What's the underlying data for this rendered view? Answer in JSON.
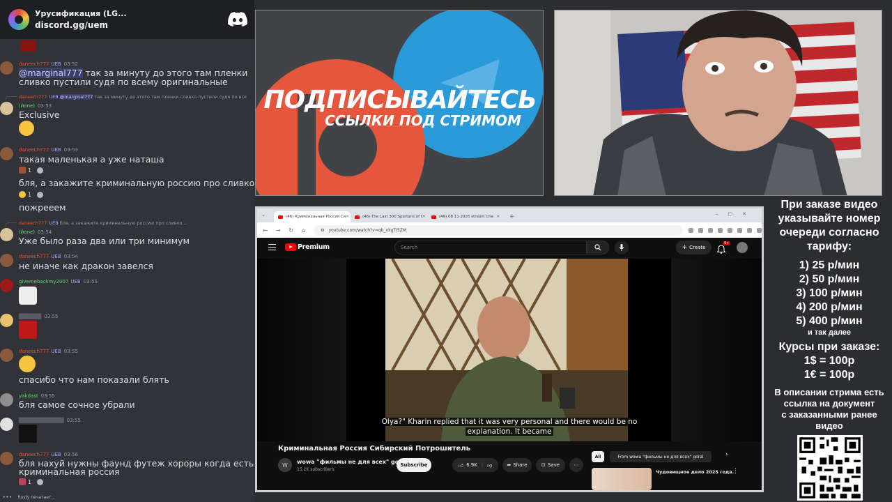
{
  "chat": {
    "server_name": "Урусификация (LG...",
    "invite": "discord.gg/uem",
    "messages": [
      {
        "user": "daneech777",
        "badge": "UEB",
        "time": "03:52",
        "mention": "@marginal777",
        "line1": " так за минуту до этого там пленки",
        "line2": "сливко пустили судя по всему оригинальные"
      },
      {
        "reply_user": "daneech777",
        "reply_badge": "UEB",
        "reply_mention": "@marginal777",
        "reply_text": "так за минуту до этого там пленки сливко пустили судя по все",
        "user": "(йоne)",
        "time": "03:53",
        "text": "Exclusive"
      },
      {
        "user": "daneech777",
        "badge": "UEB",
        "time": "03:53",
        "text": "такая маленькая а уже наташа",
        "reaction_count": "1"
      },
      {
        "text": "бля, а закажите криминальную россию про сливко...",
        "reaction_count": "1"
      },
      {
        "text": "пожрееем"
      },
      {
        "reply_user": "daneech777",
        "reply_badge": "UEB",
        "reply_text": "бля, а закажите криминальную россию про сливко...",
        "user": "(йоne)",
        "time": "03:54",
        "text": "Уже было раза два или три минимум"
      },
      {
        "user": "daneech777",
        "badge": "UEB",
        "time": "03:54",
        "text": "не иначе как дракон завелся"
      },
      {
        "user": "givemebackmy2007",
        "badge": "UEB",
        "time": "03:55"
      },
      {
        "time": "03:55"
      },
      {
        "user": "daneech777",
        "badge": "UEB",
        "time": "03:55"
      },
      {
        "text": "спасибо что нам показали блять"
      },
      {
        "user": "yakdast",
        "time": "03:55",
        "text": "бля самое сочное убрали"
      },
      {
        "time": "03:55"
      },
      {
        "user": "daneech777",
        "badge": "UEB",
        "time": "03:56",
        "line1": "бля нахуй нужны фаунд футеж хороры когда есть",
        "line2": "криминальная россия",
        "reaction_count": "1"
      }
    ],
    "typing": "Rusty печатает..."
  },
  "banner": {
    "line1": "ПОДПИСЫВАЙТЕСЬ",
    "line2": "ССЫЛКИ ПОД СТРИМОМ",
    "colors": {
      "patreon": "#e4573d",
      "telegram": "#2a9bd8"
    }
  },
  "browser": {
    "tabs": [
      {
        "label": "(46) Криминальная Россия Си",
        "active": true
      },
      {
        "label": "(46) The Last 300 Spartans of t",
        "active": false
      },
      {
        "label": "(46) 08 11 2025 stream Che",
        "active": false
      }
    ],
    "url": "youtube.com/watch?v=qb_nkgTI5ZM",
    "youtube": {
      "brand": "Premium",
      "search_placeholder": "Search",
      "create_label": "Create",
      "notif_count": "9+",
      "subtitle_line1": "Olya?\" Kharin replied that it was very personal and there would be no",
      "subtitle_line2": "explanation. It became",
      "video_title": "Криминальная Россия Сибирский Потрошитель",
      "channel_initial": "W",
      "channel_name": "wowa \"фильмы не для всех\" goral",
      "subscribers": "15.2K subscribers",
      "subscribe_label": "Subscribe",
      "likes": "6.9K",
      "share_label": "Share",
      "save_label": "Save",
      "chip_all": "All",
      "chip_from": "From wowa \"фильмы не для всех\" goral",
      "rec_title": "Чудовищное дело 2025 года."
    }
  },
  "info": {
    "order_lines": [
      "При заказе видео",
      "указывайте номер",
      "очереди согласно",
      "тарифу:"
    ],
    "tariffs": [
      "1) 25 р/мин",
      "2) 50 р/мин",
      "3) 100 р/мин",
      "4) 200 р/мин",
      "5) 400 р/мин"
    ],
    "tariffs_more": "и так далее",
    "rates_title": "Курсы при заказе:",
    "rates": [
      "1$ = 100р",
      "1€ = 100р"
    ],
    "doc_lines": [
      "В описании стрима есть",
      "ссылка на документ",
      "с заказанными ранее",
      "видео"
    ]
  }
}
